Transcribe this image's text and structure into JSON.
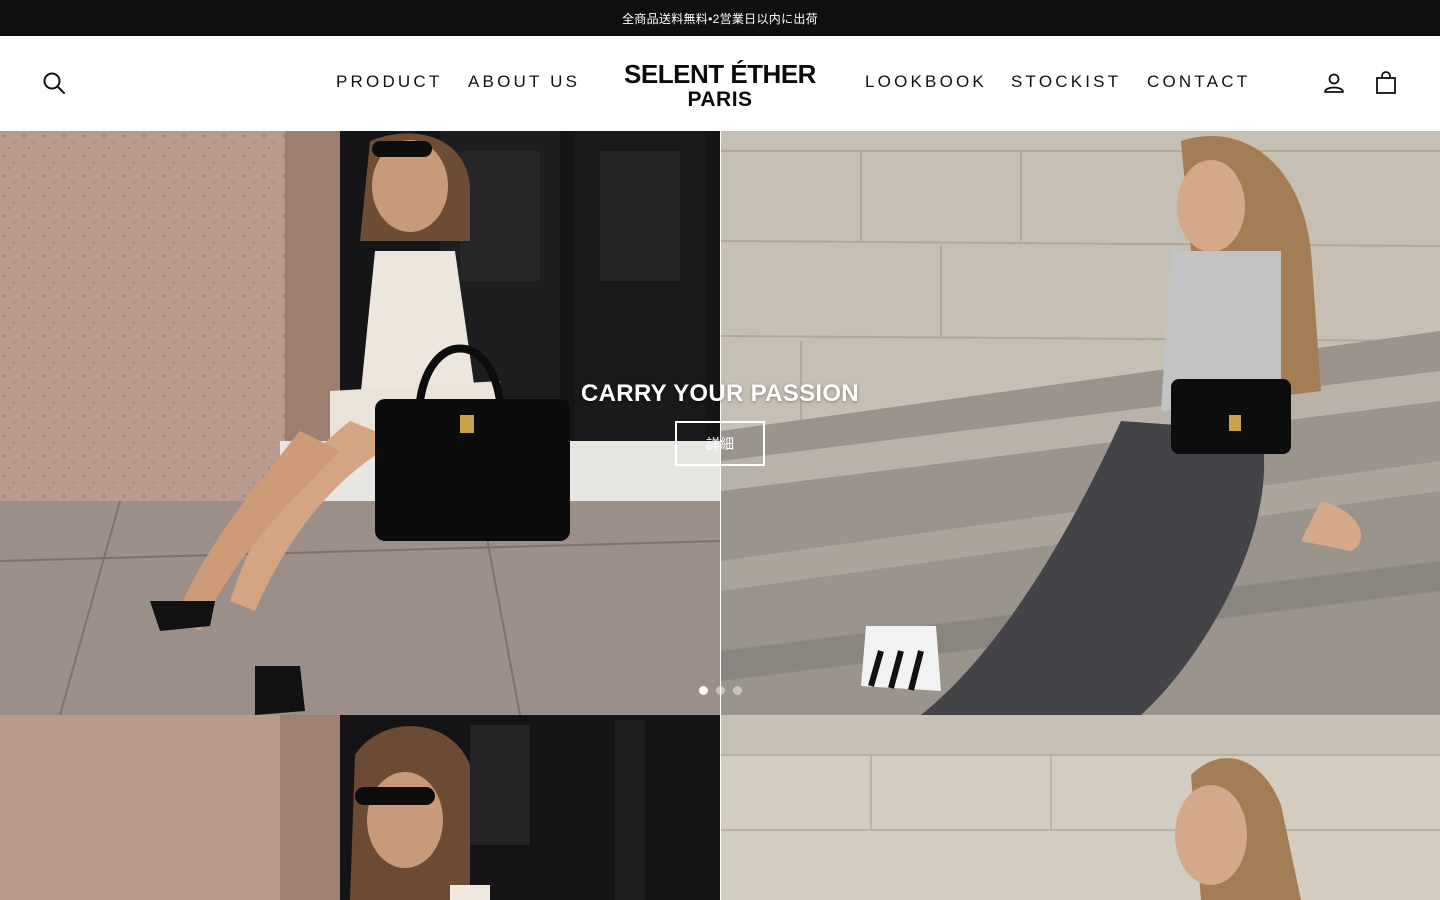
{
  "announcement": {
    "text": "全商品送料無料•2営業日以内に出荷"
  },
  "header": {
    "nav_left": [
      {
        "label": "PRODUCT"
      },
      {
        "label": "ABOUT US"
      }
    ],
    "nav_right": [
      {
        "label": "LOOKBOOK"
      },
      {
        "label": "STOCKIST"
      },
      {
        "label": "CONTACT"
      }
    ],
    "logo": {
      "line1": "SELENT ÉTHER",
      "line2": "PARIS"
    },
    "icons": {
      "search": "search-icon",
      "account": "user-icon",
      "cart": "shopping-bag-icon"
    }
  },
  "hero": {
    "title": "CARRY YOUR PASSION",
    "cta_label": "詳細",
    "slides_total": 3,
    "active_slide": 1
  },
  "colors": {
    "announcement_bg": "#0f0f0f",
    "header_bg": "#ffffff",
    "text": "#111111",
    "hero_text": "#ffffff"
  }
}
